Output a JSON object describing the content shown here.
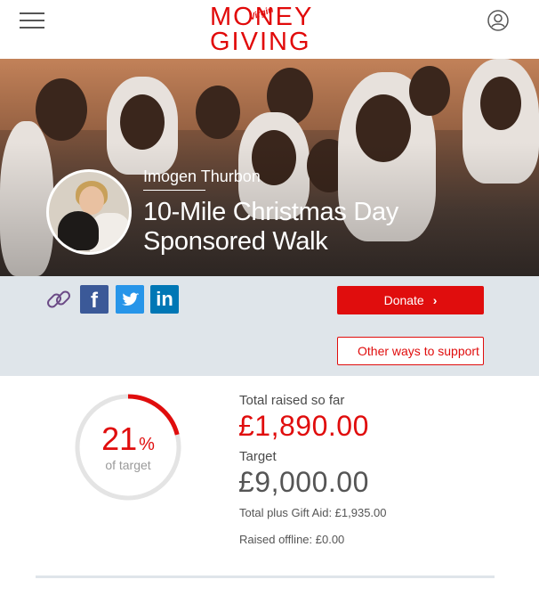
{
  "header": {
    "menu_icon": "hamburger-menu-icon",
    "logo_line1": "MONEY",
    "logo_line2": "GIVING",
    "logo_badge": "Virgin",
    "account_icon": "user-account-icon",
    "brand_color": "#e10a0a"
  },
  "hero": {
    "fundraiser_name": "Imogen Thurbon",
    "page_title": "10-Mile Christmas Day Sponsored Walk"
  },
  "share": {
    "link_icon": "link-icon",
    "facebook_icon": "facebook-icon",
    "twitter_icon": "twitter-icon",
    "linkedin_icon": "linkedin-icon",
    "linkedin_text": "in",
    "facebook_text": "f"
  },
  "actions": {
    "donate_label": "Donate",
    "donate_chevron": "›",
    "other_label": "Other ways to support"
  },
  "progress": {
    "percent": "21",
    "percent_symbol": "%",
    "caption": "of target",
    "fraction": 0.21
  },
  "stats": {
    "raised_label": "Total raised so far",
    "raised_value": "£1,890.00",
    "target_label": "Target",
    "target_value": "£9,000.00",
    "giftaid": "Total plus Gift Aid: £1,935.00",
    "offline": "Raised offline: £0.00"
  },
  "colors": {
    "accent": "#e00d0d",
    "band": "#dfe5ea",
    "facebook": "#3b5998",
    "twitter": "#2795e9",
    "linkedin": "#0077b5"
  }
}
